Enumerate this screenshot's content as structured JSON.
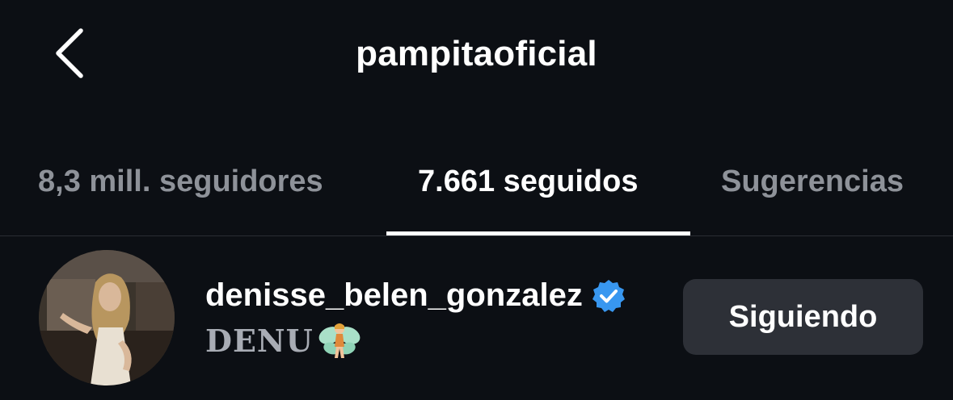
{
  "header": {
    "title": "pampitaoficial",
    "back_icon": "chevron-left-icon"
  },
  "tabs": [
    {
      "label": "8,3 mill. seguidores",
      "active": false
    },
    {
      "label": "7.661 seguidos",
      "active": true
    },
    {
      "label": "Sugerencias",
      "active": false
    }
  ],
  "accounts": [
    {
      "username": "denisse_belen_gonzalez",
      "verified": true,
      "verified_icon": "verified-badge-icon",
      "bio": "DENU",
      "bio_emoji": "fairy-icon",
      "button_label": "Siguiendo"
    }
  ],
  "colors": {
    "background": "#0c0f14",
    "verified_blue": "#3897f0",
    "button_bg": "#2d3037",
    "inactive_tab": "#8e9299"
  }
}
